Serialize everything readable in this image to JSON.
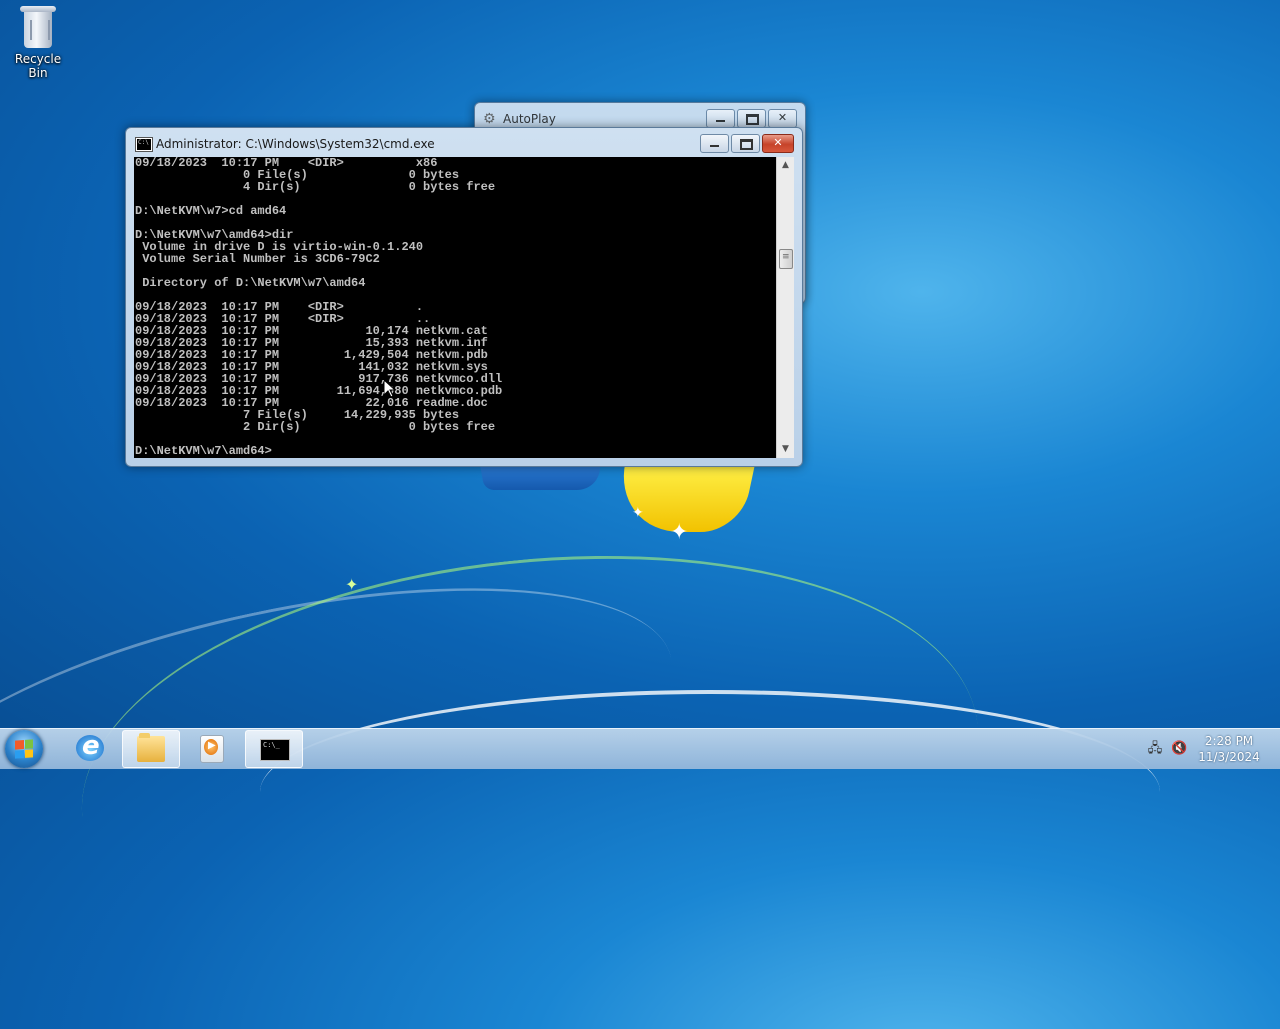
{
  "desktop": {
    "icons": [
      {
        "label": "Recycle Bin",
        "icon": "recycle-bin-icon"
      }
    ]
  },
  "autoplay_window": {
    "title": "AutoPlay"
  },
  "cmd_window": {
    "title": "Administrator: C:\\Windows\\System32\\cmd.exe",
    "lines": [
      "09/18/2023  10:17 PM    <DIR>          x86",
      "               0 File(s)              0 bytes",
      "               4 Dir(s)               0 bytes free",
      "",
      "D:\\NetKVM\\w7>cd amd64",
      "",
      "D:\\NetKVM\\w7\\amd64>dir",
      " Volume in drive D is virtio-win-0.1.240",
      " Volume Serial Number is 3CD6-79C2",
      "",
      " Directory of D:\\NetKVM\\w7\\amd64",
      "",
      "09/18/2023  10:17 PM    <DIR>          .",
      "09/18/2023  10:17 PM    <DIR>          ..",
      "09/18/2023  10:17 PM            10,174 netkvm.cat",
      "09/18/2023  10:17 PM            15,393 netkvm.inf",
      "09/18/2023  10:17 PM         1,429,504 netkvm.pdb",
      "09/18/2023  10:17 PM           141,032 netkvm.sys",
      "09/18/2023  10:17 PM           917,736 netkvmco.dll",
      "09/18/2023  10:17 PM        11,694,080 netkvmco.pdb",
      "09/18/2023  10:17 PM            22,016 readme.doc",
      "               7 File(s)     14,229,935 bytes",
      "               2 Dir(s)               0 bytes free",
      "",
      "D:\\NetKVM\\w7\\amd64>"
    ]
  },
  "taskbar": {
    "buttons": [
      {
        "name": "internet-explorer",
        "icon": "ie-icon"
      },
      {
        "name": "windows-explorer",
        "icon": "folder-icon"
      },
      {
        "name": "media-player",
        "icon": "media-player-icon"
      },
      {
        "name": "command-prompt",
        "icon": "cmd-icon"
      }
    ],
    "tray": {
      "icons": [
        "network-icon",
        "volume-muted-icon"
      ]
    },
    "clock": {
      "time": "2:28 PM",
      "date": "11/3/2024"
    }
  }
}
